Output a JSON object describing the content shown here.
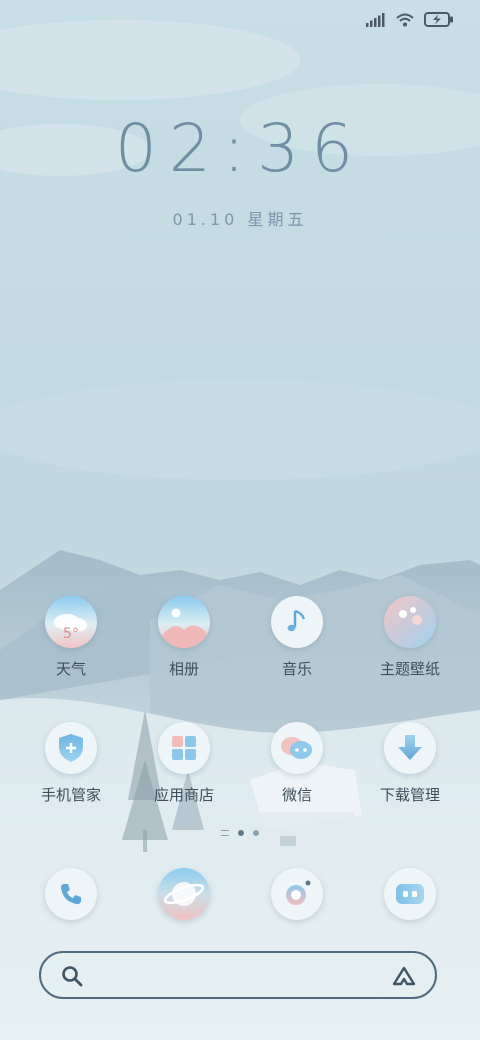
{
  "clock": {
    "time": "02:36",
    "date": "01.10 星期五"
  },
  "status_bar": {
    "icons": [
      "signal-icon",
      "wifi-icon",
      "battery-charging-icon"
    ]
  },
  "apps": [
    {
      "label": "天气",
      "icon": "weather-icon",
      "badge": "5°"
    },
    {
      "label": "相册",
      "icon": "gallery-icon"
    },
    {
      "label": "音乐",
      "icon": "music-icon"
    },
    {
      "label": "主题壁纸",
      "icon": "theme-palette-icon"
    },
    {
      "label": "手机管家",
      "icon": "phone-manager-shield-icon"
    },
    {
      "label": "应用商店",
      "icon": "app-store-icon"
    },
    {
      "label": "微信",
      "icon": "wechat-icon"
    },
    {
      "label": "下载管理",
      "icon": "download-arrow-icon"
    }
  ],
  "pager": {
    "pages": 2,
    "active_index": 0
  },
  "dock": [
    {
      "icon": "phone-icon"
    },
    {
      "icon": "browser-planet-icon"
    },
    {
      "icon": "camera-icon"
    },
    {
      "icon": "messages-icon"
    }
  ],
  "search": {
    "icons": [
      "search-icon",
      "assistant-icon"
    ]
  }
}
